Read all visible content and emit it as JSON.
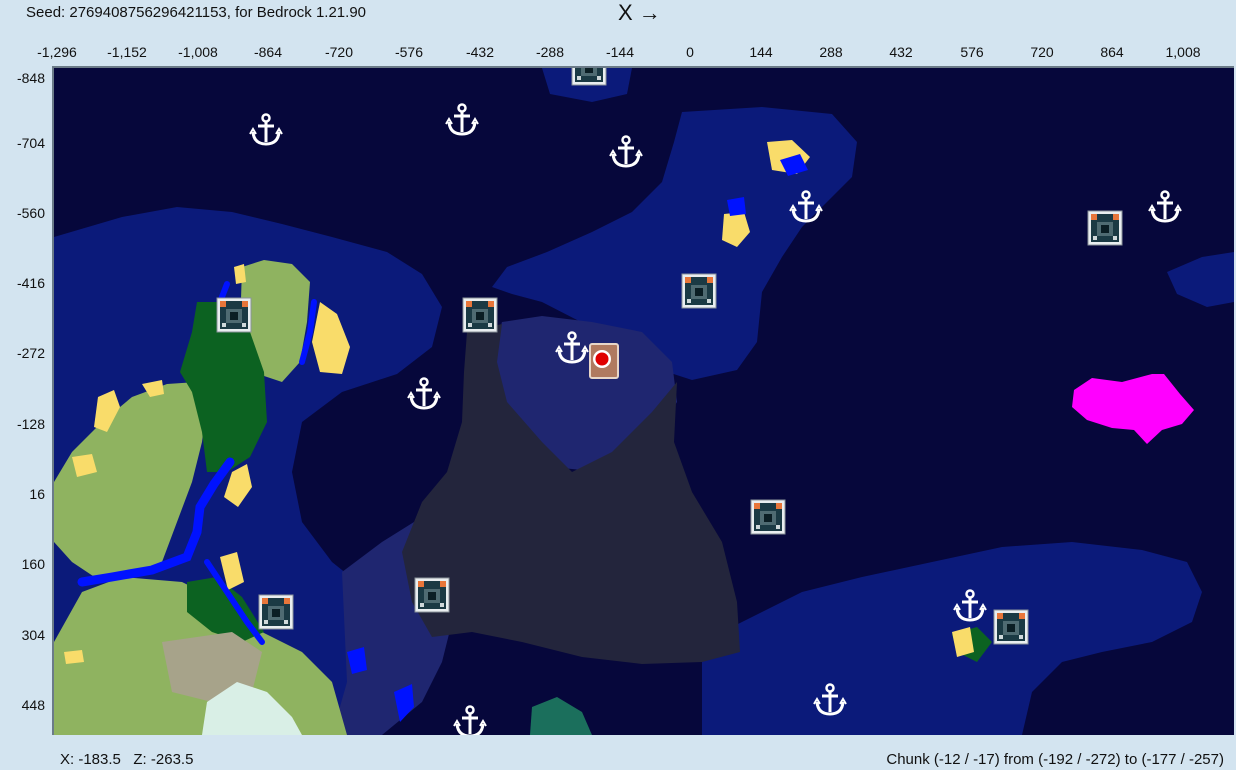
{
  "header": {
    "seed_text": "Seed: 2769408756296421153, for Bedrock 1.21.90",
    "x_axis_label": "X →"
  },
  "axes": {
    "x_ticks": [
      "-1,296",
      "-1,152",
      "-1,008",
      "-864",
      "-720",
      "-576",
      "-432",
      "-288",
      "-144",
      "0",
      "144",
      "288",
      "432",
      "576",
      "720",
      "864",
      "1,008"
    ],
    "z_ticks": [
      "-848",
      "-704",
      "-560",
      "-416",
      "-272",
      "-128",
      "16",
      "160",
      "304",
      "448"
    ]
  },
  "status": {
    "coords_x": "X: -183.5",
    "coords_z": "Z: -263.5",
    "chunk_text": "Chunk (-12 / -17) from (-192 / -272) to (-177 / -257)"
  },
  "map": {
    "colors": {
      "deep_ocean": "#06073b",
      "ocean": "#0b1a7a",
      "lukewarm_ocean": "#1f2670",
      "deep_dark_area": "#23253c",
      "river": "#0012ff",
      "beach": "#f9dc6a",
      "plains": "#8fb360",
      "forest": "#0c6221",
      "mushroom": "#ff00ff",
      "snowy": "#d9efe6",
      "hills": "#a7a38a",
      "spawn_marker": "#e00000"
    },
    "icons": {
      "anchor": "anchor-icon",
      "monument": "ocean-monument-icon",
      "spawn": "spawn-marker-icon"
    }
  }
}
